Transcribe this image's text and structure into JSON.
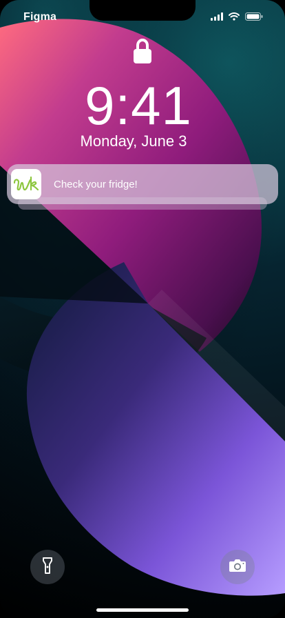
{
  "status_bar": {
    "carrier": "Figma",
    "icons": [
      "signal-icon",
      "wifi-icon",
      "battery-icon"
    ]
  },
  "lock_screen": {
    "lock_icon": "lock-icon",
    "time": "9:41",
    "date": "Monday, June 3"
  },
  "notification": {
    "app_icon": "wk-app-icon",
    "message": "Check your fridge!"
  },
  "quick_actions": {
    "flashlight_icon": "flashlight-icon",
    "camera_icon": "camera-icon"
  },
  "colors": {
    "pink": "#ff6b7f",
    "magenta": "#9b1b8c",
    "purple": "#7b55d8",
    "teal": "#0f5b63",
    "app_icon_green": "#8dc63f"
  }
}
